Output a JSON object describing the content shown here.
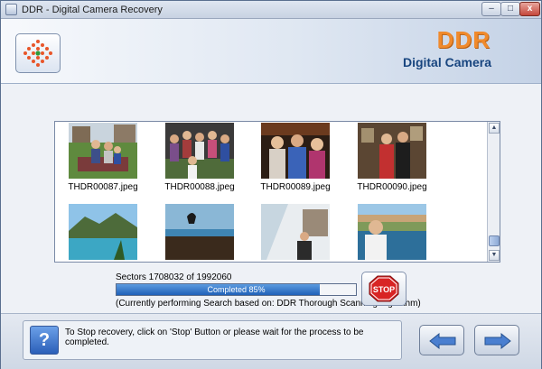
{
  "window": {
    "title": "DDR - Digital Camera Recovery"
  },
  "header": {
    "brand": "DDR",
    "product": "Digital Camera"
  },
  "thumbnails": [
    {
      "name": "THDR00087.jpeg",
      "scene": "group-on-lawn"
    },
    {
      "name": "THDR00088.jpeg",
      "scene": "group-crowd"
    },
    {
      "name": "THDR00089.jpeg",
      "scene": "three-people-indoor"
    },
    {
      "name": "THDR00090.jpeg",
      "scene": "two-men-room"
    },
    {
      "name": "",
      "scene": "sea-mountain"
    },
    {
      "name": "",
      "scene": "bird-sea"
    },
    {
      "name": "",
      "scene": "person-rotated"
    },
    {
      "name": "",
      "scene": "man-boat"
    }
  ],
  "progress": {
    "sectors_text": "Sectors  1708032 of 1992060",
    "fraction": 0.85,
    "label": "Completed 85%",
    "info": "(Currently performing Search based on:  DDR Thorough Scanning Algorithm)"
  },
  "stop_button": {
    "label": "STOP"
  },
  "footer": {
    "help_text": "To Stop recovery, click on 'Stop' Button or please wait for the process to be completed.",
    "help_icon": "?"
  },
  "controls": {
    "minimize": "–",
    "maximize": "□",
    "close": "x",
    "scroll_up": "▲",
    "scroll_down": "▼"
  }
}
